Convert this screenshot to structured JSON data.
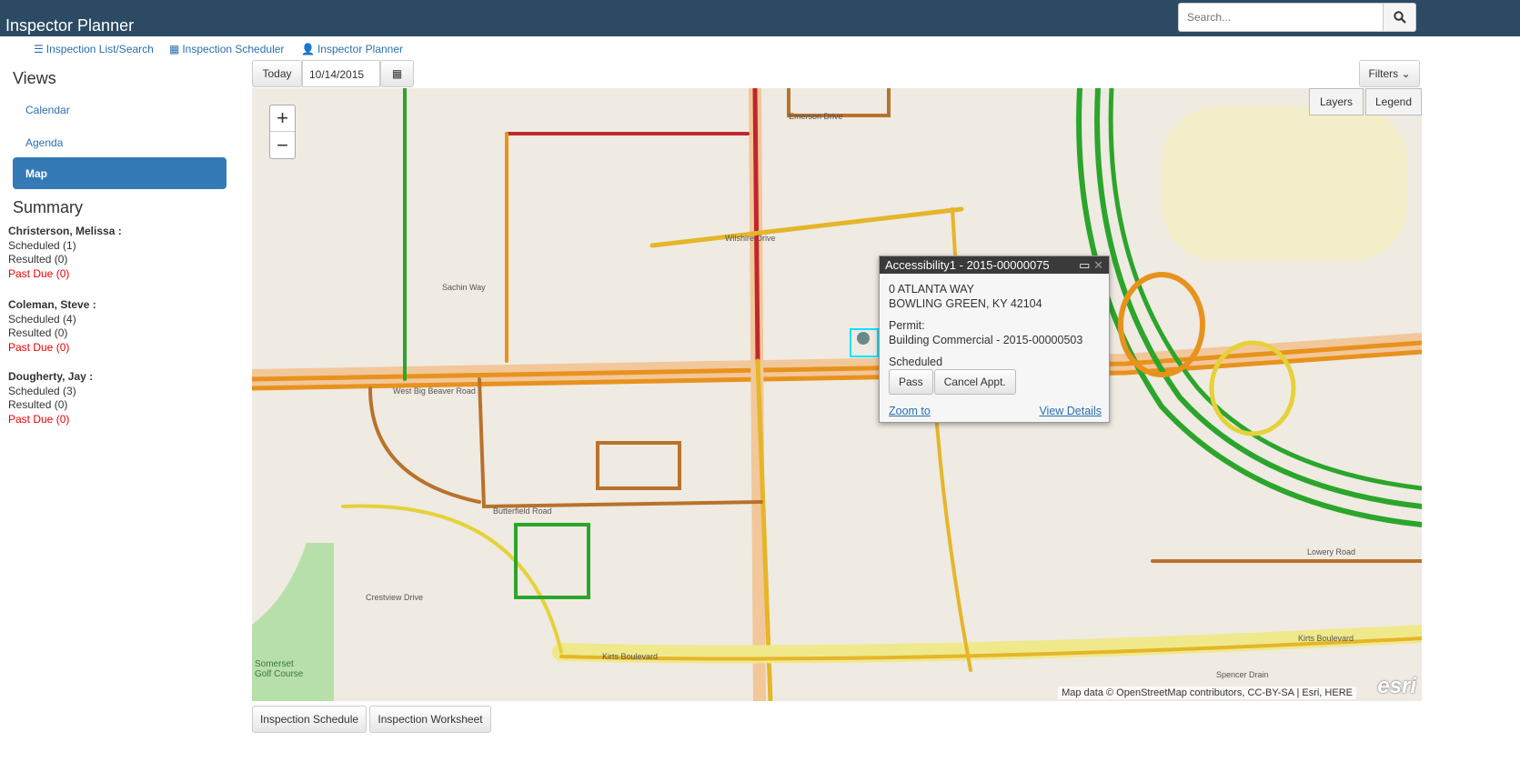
{
  "header": {
    "title": "Inspector Planner",
    "search_placeholder": "Search..."
  },
  "nav": [
    {
      "label": "Inspection List/Search",
      "icon": "list-icon"
    },
    {
      "label": "Inspection Scheduler",
      "icon": "calendar-icon"
    },
    {
      "label": "Inspector Planner",
      "icon": "user-icon"
    }
  ],
  "sidebar": {
    "views_title": "Views",
    "views": [
      {
        "label": "Calendar"
      },
      {
        "label": "Agenda"
      },
      {
        "label": "Map",
        "active": true
      }
    ],
    "summary_title": "Summary",
    "inspectors": [
      {
        "name": "Christerson, Melissa :",
        "scheduled": "Scheduled (1)",
        "resulted": "Resulted (0)",
        "past_due": "Past Due (0)"
      },
      {
        "name": "Coleman, Steve :",
        "scheduled": "Scheduled (4)",
        "resulted": "Resulted (0)",
        "past_due": "Past Due (0)"
      },
      {
        "name": "Dougherty, Jay :",
        "scheduled": "Scheduled (3)",
        "resulted": "Resulted (0)",
        "past_due": "Past Due (0)"
      }
    ]
  },
  "toolbar": {
    "today": "Today",
    "date": "10/14/2015",
    "filters": "Filters"
  },
  "map": {
    "layers": "Layers",
    "legend": "Legend",
    "zoom_in": "+",
    "zoom_out": "−",
    "attribution": "Map data © OpenStreetMap contributors, CC-BY-SA | Esri, HERE",
    "logo": "esri",
    "labels": {
      "emerson": "Emerson Drive",
      "wilshire": "Wilshire Drive",
      "sachin": "Sachin Way",
      "bigbeaver": "West Big Beaver Road",
      "butterfield": "Butterfield Road",
      "kirts": "Kirts Boulevard",
      "kirts2": "Kirts Boulevard",
      "lowery": "Lowery Road",
      "golf": "Somerset Golf Course",
      "spencer": "Spencer Drain",
      "crestview": "Crestview Drive"
    },
    "popup": {
      "title": "Accessibility1 - 2015-00000075",
      "address1": "0 ATLANTA WAY",
      "address2": "BOWLING GREEN, KY 42104",
      "permit_label": "Permit:",
      "permit": "Building Commercial - 2015-00000503",
      "status": "Scheduled",
      "pass": "Pass",
      "cancel": "Cancel Appt.",
      "zoom_to": "Zoom to",
      "view_details": "View Details"
    }
  },
  "footer": {
    "schedule": "Inspection Schedule",
    "worksheet": "Inspection Worksheet"
  }
}
